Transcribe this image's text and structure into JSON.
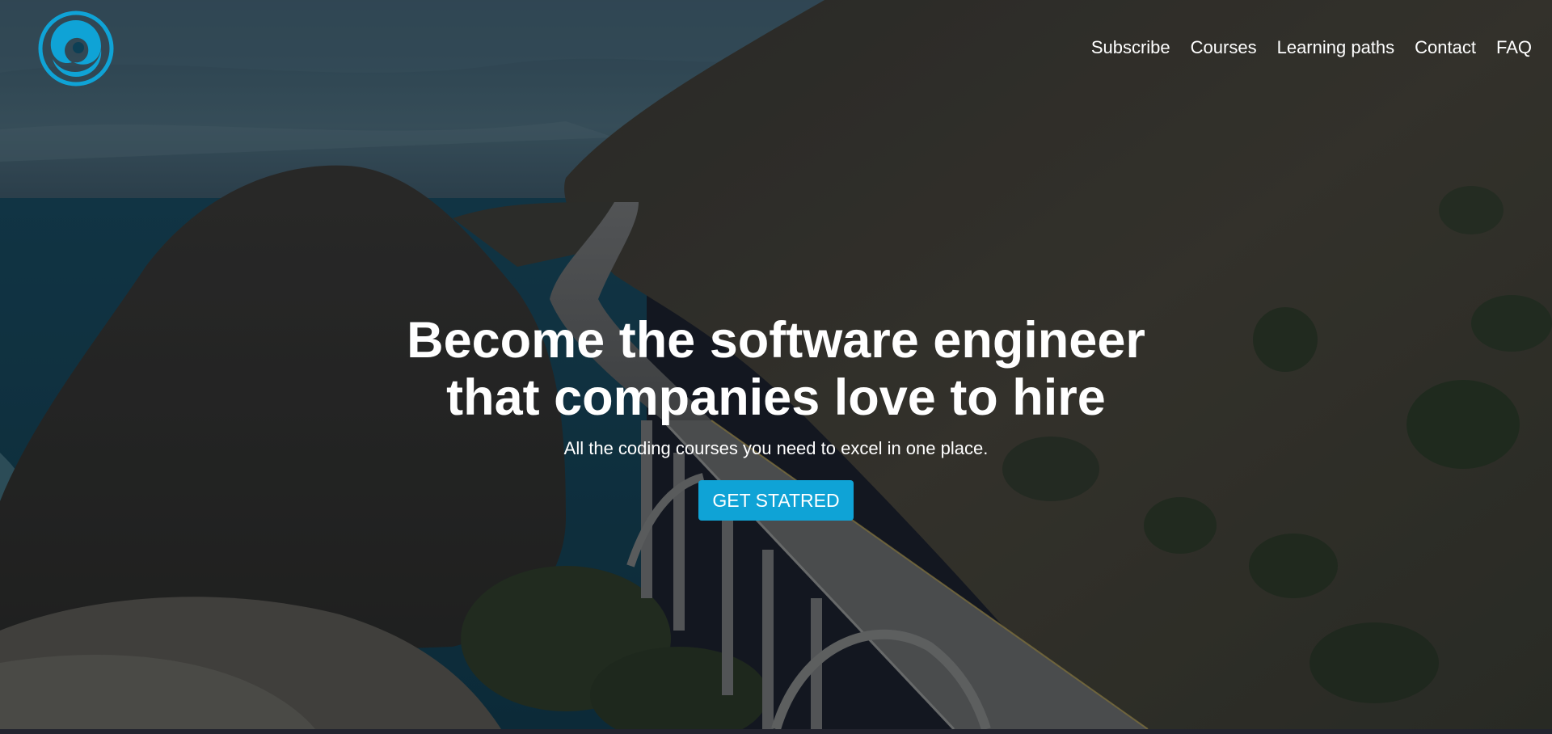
{
  "header": {
    "logo_icon": "swirl-logo-icon",
    "nav": [
      {
        "label": "Subscribe"
      },
      {
        "label": "Courses"
      },
      {
        "label": "Learning paths"
      },
      {
        "label": "Contact"
      },
      {
        "label": "FAQ"
      }
    ]
  },
  "hero": {
    "headline_line1": "Become the software engineer",
    "headline_line2": "that companies love to hire",
    "subtitle": "All the coding courses you need to excel in one place.",
    "cta_label": "GET STATRED",
    "background": "coastal highway bridge aerial photo"
  },
  "colors": {
    "accent": "#0fa3d6",
    "text": "#ffffff"
  }
}
